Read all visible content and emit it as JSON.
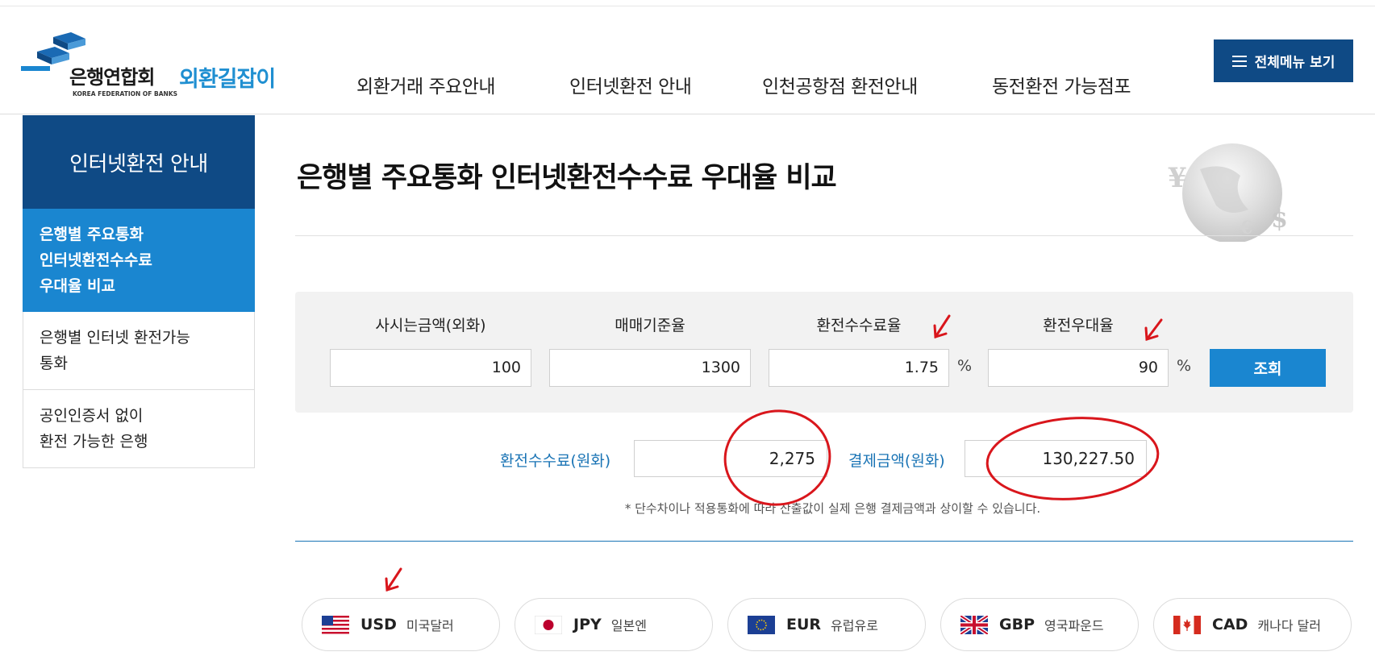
{
  "header": {
    "logo_kfb": "은행연합회",
    "logo_kfb_en": "KOREA FEDERATION OF BANKS",
    "logo_title": "외환길잡이",
    "nav": [
      {
        "label": "외환거래 주요안내"
      },
      {
        "label": "인터넷환전 안내"
      },
      {
        "label": "인천공항점 환전안내"
      },
      {
        "label": "동전환전 가능점포"
      }
    ],
    "all_menu_label": "전체메뉴 보기"
  },
  "sidebar": {
    "title": "인터넷환전 안내",
    "items": [
      {
        "lines": [
          "은행별 주요통화",
          "인터넷환전수수료",
          "우대율 비교"
        ]
      },
      {
        "lines": [
          "은행별 인터넷 환전가능",
          "통화"
        ]
      },
      {
        "lines": [
          "공인인증서 없이",
          "환전 가능한 은행"
        ]
      }
    ]
  },
  "main": {
    "title": "은행별 주요통화 인터넷환전수수료 우대율 비교",
    "form": {
      "amount_label": "사시는금액(외화)",
      "amount_value": "100",
      "base_rate_label": "매매기준율",
      "base_rate_value": "1300",
      "fee_rate_label": "환전수수료율",
      "fee_rate_value": "1.75",
      "pref_rate_label": "환전우대율",
      "pref_rate_value": "90",
      "percent": "%",
      "search_label": "조회"
    },
    "result": {
      "fee_label": "환전수수료(원화)",
      "fee_value": "2,275",
      "pay_label": "결제금액(원화)",
      "pay_value": "130,227.50"
    },
    "notice": "* 단수차이나 적용통화에 따라 산출값이 실제 은행 결제금액과 상이할 수 있습니다.",
    "currencies": [
      {
        "code": "USD",
        "name": "미국달러"
      },
      {
        "code": "JPY",
        "name": "일본엔"
      },
      {
        "code": "EUR",
        "name": "유럽유로"
      },
      {
        "code": "GBP",
        "name": "영국파운드"
      },
      {
        "code": "CAD",
        "name": "캐나다 달러"
      }
    ]
  },
  "colors": {
    "navy": "#0f4a85",
    "blue": "#1a86d0",
    "annotation_red": "#d9161c"
  }
}
